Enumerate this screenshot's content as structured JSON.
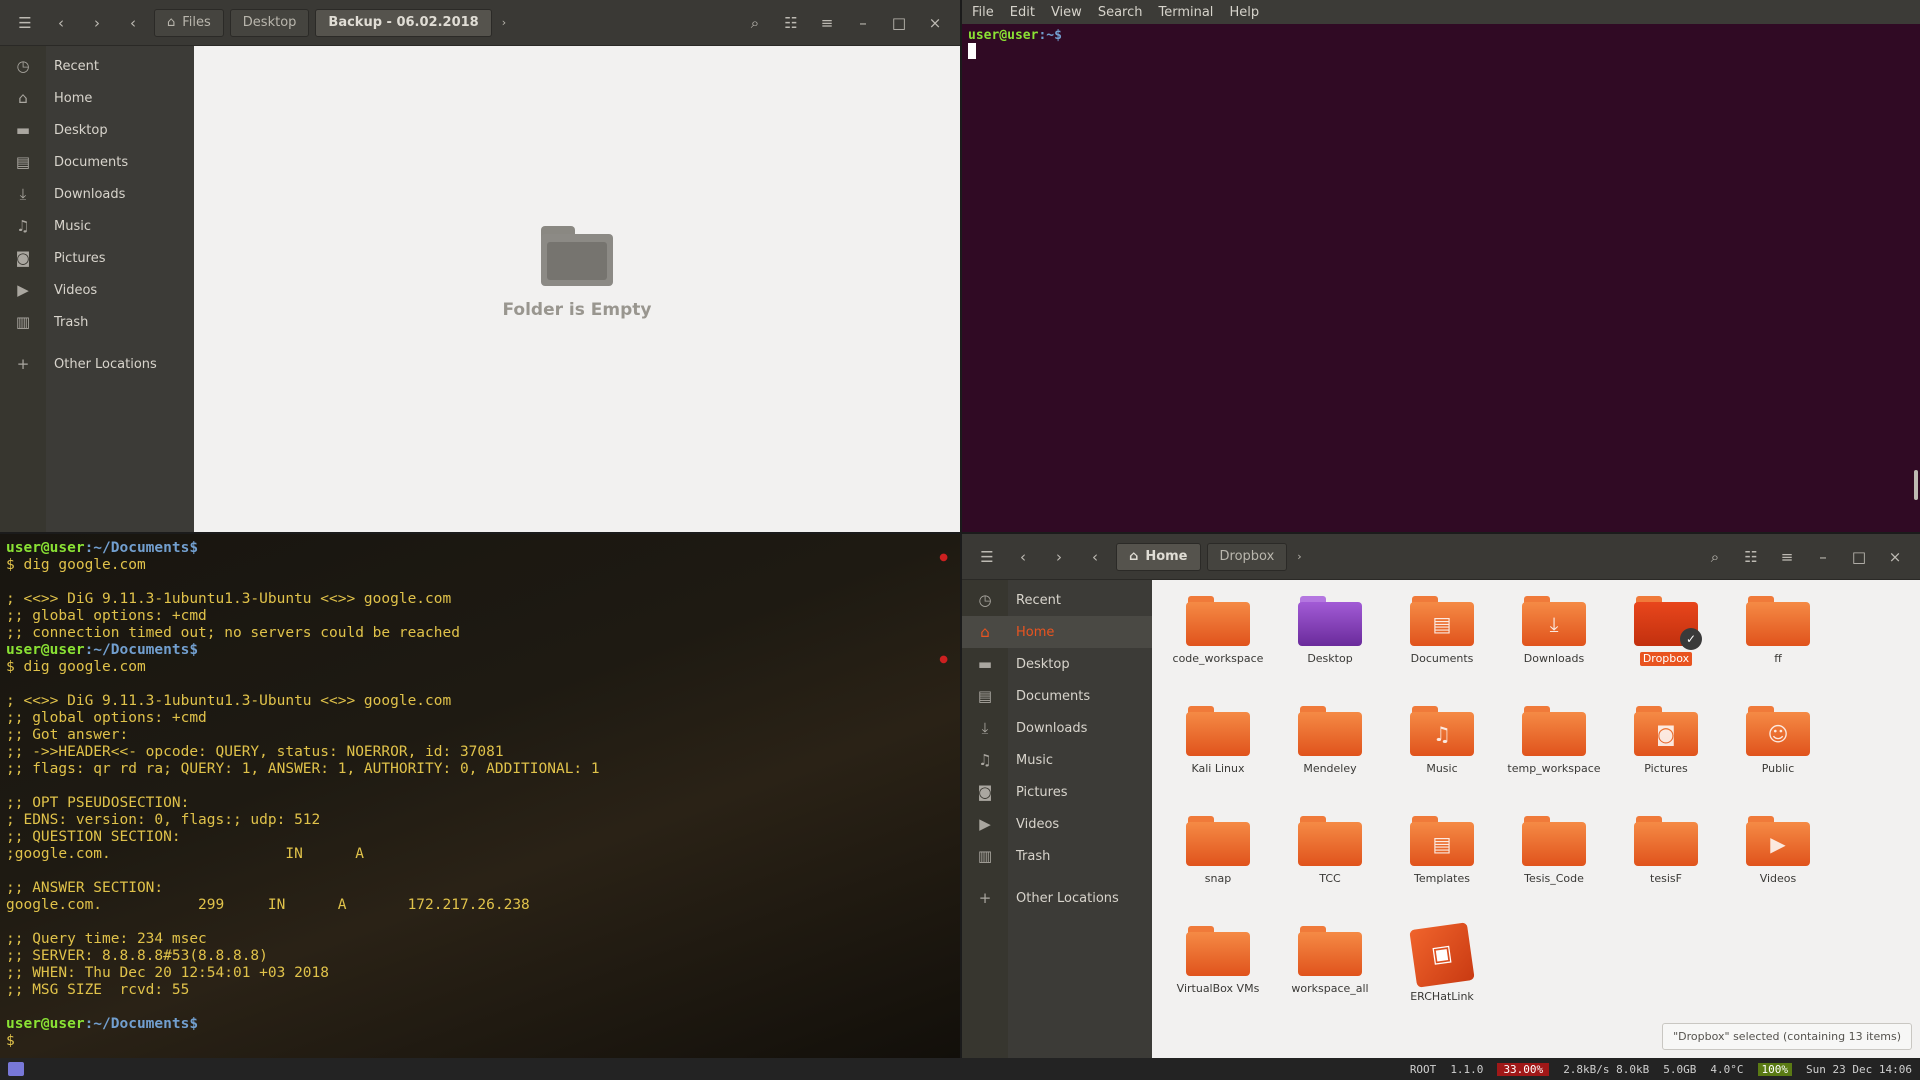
{
  "top_left_fm": {
    "nav_path": [
      "Files",
      "Desktop",
      "Backup - 06.02.2018"
    ],
    "sidebar": [
      "Recent",
      "Home",
      "Desktop",
      "Documents",
      "Downloads",
      "Music",
      "Pictures",
      "Videos",
      "Trash",
      "Other Locations"
    ],
    "sidebar_icons": [
      "clock-icon",
      "home-icon",
      "folder-icon",
      "document-icon",
      "download-icon",
      "music-icon",
      "camera-icon",
      "video-icon",
      "trash-icon",
      "plus-icon"
    ],
    "empty_message": "Folder is Empty"
  },
  "top_right_terminal": {
    "menu": [
      "File",
      "Edit",
      "View",
      "Search",
      "Terminal",
      "Help"
    ],
    "prompt_user": "user@user",
    "prompt_path": ":~$"
  },
  "bottom_left_terminal": {
    "lines": [
      {
        "t": "prompt"
      },
      {
        "t": "cmd",
        "text": "$ dig google.com"
      },
      {
        "t": "text",
        "text": ""
      },
      {
        "t": "text",
        "text": "; <<>> DiG 9.11.3-1ubuntu1.3-Ubuntu <<>> google.com"
      },
      {
        "t": "text",
        "text": ";; global options: +cmd"
      },
      {
        "t": "text",
        "text": ";; connection timed out; no servers could be reached"
      },
      {
        "t": "prompt"
      },
      {
        "t": "cmd",
        "text": "$ dig google.com"
      },
      {
        "t": "text",
        "text": ""
      },
      {
        "t": "text",
        "text": "; <<>> DiG 9.11.3-1ubuntu1.3-Ubuntu <<>> google.com"
      },
      {
        "t": "text",
        "text": ";; global options: +cmd"
      },
      {
        "t": "text",
        "text": ";; Got answer:"
      },
      {
        "t": "text",
        "text": ";; ->>HEADER<<- opcode: QUERY, status: NOERROR, id: 37081"
      },
      {
        "t": "text",
        "text": ";; flags: qr rd ra; QUERY: 1, ANSWER: 1, AUTHORITY: 0, ADDITIONAL: 1"
      },
      {
        "t": "text",
        "text": ""
      },
      {
        "t": "text",
        "text": ";; OPT PSEUDOSECTION:"
      },
      {
        "t": "text",
        "text": "; EDNS: version: 0, flags:; udp: 512"
      },
      {
        "t": "text",
        "text": ";; QUESTION SECTION:"
      },
      {
        "t": "text",
        "text": ";google.com.                    IN      A"
      },
      {
        "t": "text",
        "text": ""
      },
      {
        "t": "text",
        "text": ";; ANSWER SECTION:"
      },
      {
        "t": "text",
        "text": "google.com.           299     IN      A       172.217.26.238"
      },
      {
        "t": "text",
        "text": ""
      },
      {
        "t": "text",
        "text": ";; Query time: 234 msec"
      },
      {
        "t": "text",
        "text": ";; SERVER: 8.8.8.8#53(8.8.8.8)"
      },
      {
        "t": "text",
        "text": ";; WHEN: Thu Dec 20 12:54:01 +03 2018"
      },
      {
        "t": "text",
        "text": ";; MSG SIZE  rcvd: 55"
      },
      {
        "t": "text",
        "text": ""
      },
      {
        "t": "prompt"
      },
      {
        "t": "cmd",
        "text": "$"
      }
    ],
    "prompt_user": "user@user",
    "prompt_path": ":~/Documents$"
  },
  "bottom_right_fm": {
    "nav_path": [
      "Home",
      "Dropbox"
    ],
    "sidebar": [
      "Recent",
      "Home",
      "Desktop",
      "Documents",
      "Downloads",
      "Music",
      "Pictures",
      "Videos",
      "Trash",
      "Other Locations"
    ],
    "sidebar_icons": [
      "clock-icon",
      "home-icon",
      "folder-icon",
      "document-icon",
      "download-icon",
      "music-icon",
      "camera-icon",
      "video-icon",
      "trash-icon",
      "plus-icon"
    ],
    "selected_sidebar": "Home",
    "items": [
      {
        "label": "code_workspace",
        "kind": "plain"
      },
      {
        "label": "Desktop",
        "kind": "desktop"
      },
      {
        "label": "Documents",
        "kind": "doc"
      },
      {
        "label": "Downloads",
        "kind": "download"
      },
      {
        "label": "Dropbox",
        "kind": "dropbox"
      },
      {
        "label": "ff",
        "kind": "plain"
      },
      {
        "label": "Kali Linux",
        "kind": "plain"
      },
      {
        "label": "Mendeley",
        "kind": "plain"
      },
      {
        "label": "Music",
        "kind": "music"
      },
      {
        "label": "temp_workspace",
        "kind": "plain"
      },
      {
        "label": "Pictures",
        "kind": "pictures"
      },
      {
        "label": "Public",
        "kind": "public"
      },
      {
        "label": "snap",
        "kind": "plain"
      },
      {
        "label": "TCC",
        "kind": "plain"
      },
      {
        "label": "Templates",
        "kind": "doc"
      },
      {
        "label": "Tesis_Code",
        "kind": "plain"
      },
      {
        "label": "tesisF",
        "kind": "plain"
      },
      {
        "label": "Videos",
        "kind": "video"
      },
      {
        "label": "VirtualBox VMs",
        "kind": "plain"
      },
      {
        "label": "workspace_all",
        "kind": "plain"
      },
      {
        "label": "ERCHatLink",
        "kind": "box"
      }
    ],
    "selected_item": "Dropbox",
    "status": "\"Dropbox\" selected (containing 13 items)"
  },
  "panel": {
    "items": [
      "ROOT",
      "1.1.0",
      "33.00%",
      "2.8kB/s 8.0kB",
      "5.0GB",
      "4.0°C",
      "100%",
      "Sun 23 Dec 14:06"
    ]
  }
}
